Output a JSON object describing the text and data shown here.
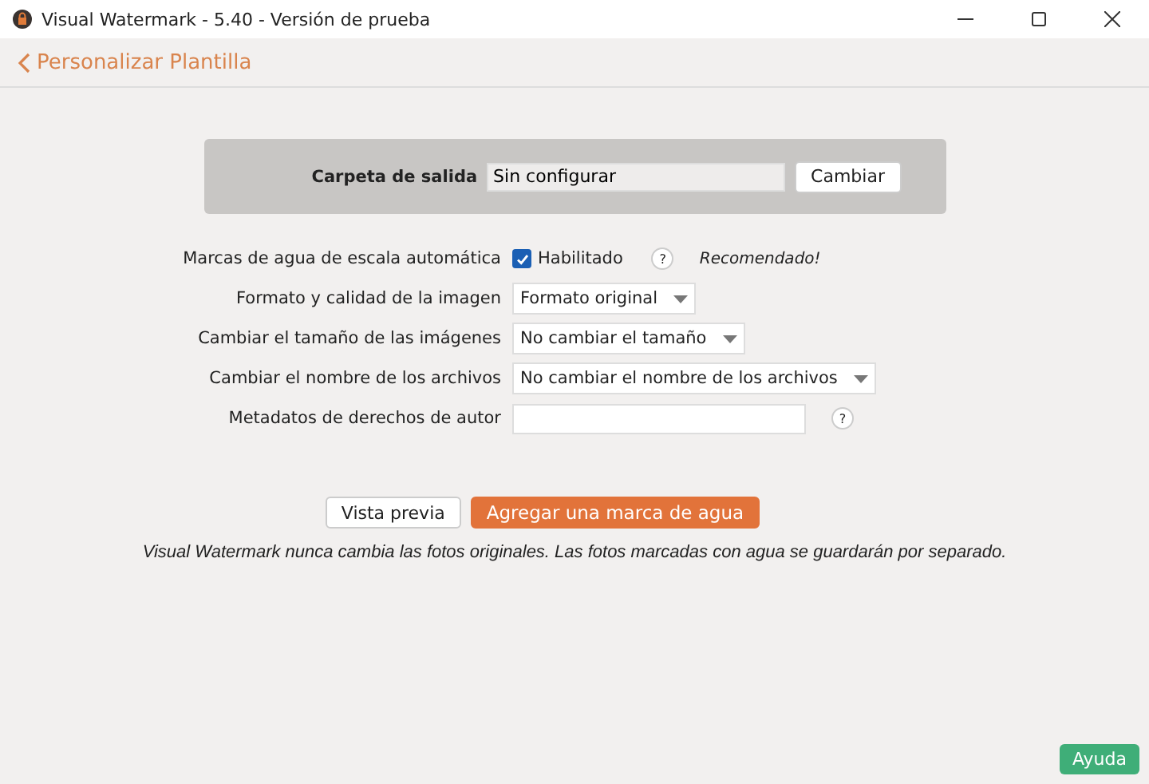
{
  "window": {
    "title": "Visual Watermark - 5.40 - Versión de prueba"
  },
  "header": {
    "back_label": "Personalizar Plantilla"
  },
  "output": {
    "label": "Carpeta de salida",
    "value": "Sin configurar",
    "button": "Cambiar"
  },
  "rows": [
    {
      "kind": "checkbox",
      "label": "Marcas de agua de escala automática",
      "option": "Habilitado",
      "checked": true,
      "help": "?",
      "note": "Recomendado!"
    },
    {
      "kind": "select",
      "label": "Formato y calidad de la imagen",
      "value": "Formato original"
    },
    {
      "kind": "select",
      "label": "Cambiar el tamaño de las imágenes",
      "value": "No cambiar el tamaño"
    },
    {
      "kind": "select",
      "label": "Cambiar el nombre de los archivos",
      "value": "No cambiar el nombre de los archivos"
    },
    {
      "kind": "text",
      "label": "Metadatos de derechos de autor",
      "help": "?"
    }
  ],
  "actions": {
    "preview": "Vista previa",
    "primary": "Agregar una marca de agua"
  },
  "note": "Visual Watermark nunca cambia las fotos originales. Las fotos marcadas con agua se guardarán por separado.",
  "help_button": "Ayuda"
}
